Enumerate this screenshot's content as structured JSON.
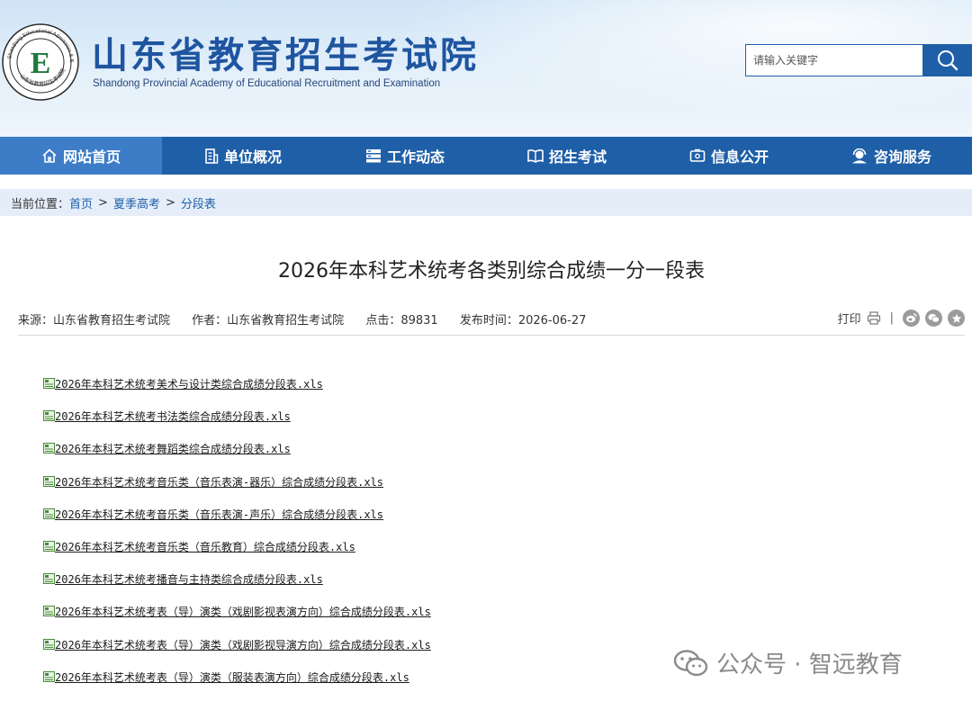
{
  "header": {
    "title": "山东省教育招生考试院",
    "subtitle": "Shandong Provincial Academy of Educational Recruitment and Examination",
    "seal_text": "Shandong Educational Admission & Examination",
    "seal_bottom_text": "山东省教育招生考试院",
    "seal_letter": "E"
  },
  "search": {
    "placeholder": "请输入关键字"
  },
  "nav": {
    "items": [
      {
        "label": "网站首页",
        "icon": "home-icon",
        "active": true
      },
      {
        "label": "单位概况",
        "icon": "building-icon"
      },
      {
        "label": "工作动态",
        "icon": "list-icon"
      },
      {
        "label": "招生考试",
        "icon": "book-icon"
      },
      {
        "label": "信息公开",
        "icon": "info-card-icon"
      },
      {
        "label": "咨询服务",
        "icon": "user-service-icon"
      }
    ]
  },
  "breadcrumb": {
    "prefix": "当前位置：",
    "items": [
      "首页",
      "夏季高考",
      "分段表"
    ],
    "separator": ">"
  },
  "article": {
    "title": "2026年本科艺术统考各类别综合成绩一分一段表",
    "meta": {
      "source": "来源：山东省教育招生考试院",
      "author": "作者：山东省教育招生考试院",
      "clicks": "点击：89831",
      "date": "发布时间：2026-06-27"
    },
    "print_label": "打印",
    "divider": "|"
  },
  "files": [
    "2026年本科艺术统考美术与设计类综合成绩分段表.xls",
    "2026年本科艺术统考书法类综合成绩分段表.xls",
    "2026年本科艺术统考舞蹈类综合成绩分段表.xls",
    "2026年本科艺术统考音乐类（音乐表演-器乐）综合成绩分段表.xls",
    "2026年本科艺术统考音乐类（音乐表演-声乐）综合成绩分段表.xls",
    "2026年本科艺术统考音乐类（音乐教育）综合成绩分段表.xls",
    "2026年本科艺术统考播音与主持类综合成绩分段表.xls",
    "2026年本科艺术统考表（导）演类（戏剧影视表演方向）综合成绩分段表.xls",
    "2026年本科艺术统考表（导）演类（戏剧影视导演方向）综合成绩分段表.xls",
    "2026年本科艺术统考表（导）演类（服装表演方向）综合成绩分段表.xls"
  ],
  "watermark": {
    "text": "公众号 · 智远教育"
  },
  "colors": {
    "brand_blue": "#1f5fa8",
    "nav_active": "#3d7dc8",
    "breadcrumb_bg": "#e5eef8",
    "title_blue": "#1f55a0"
  }
}
